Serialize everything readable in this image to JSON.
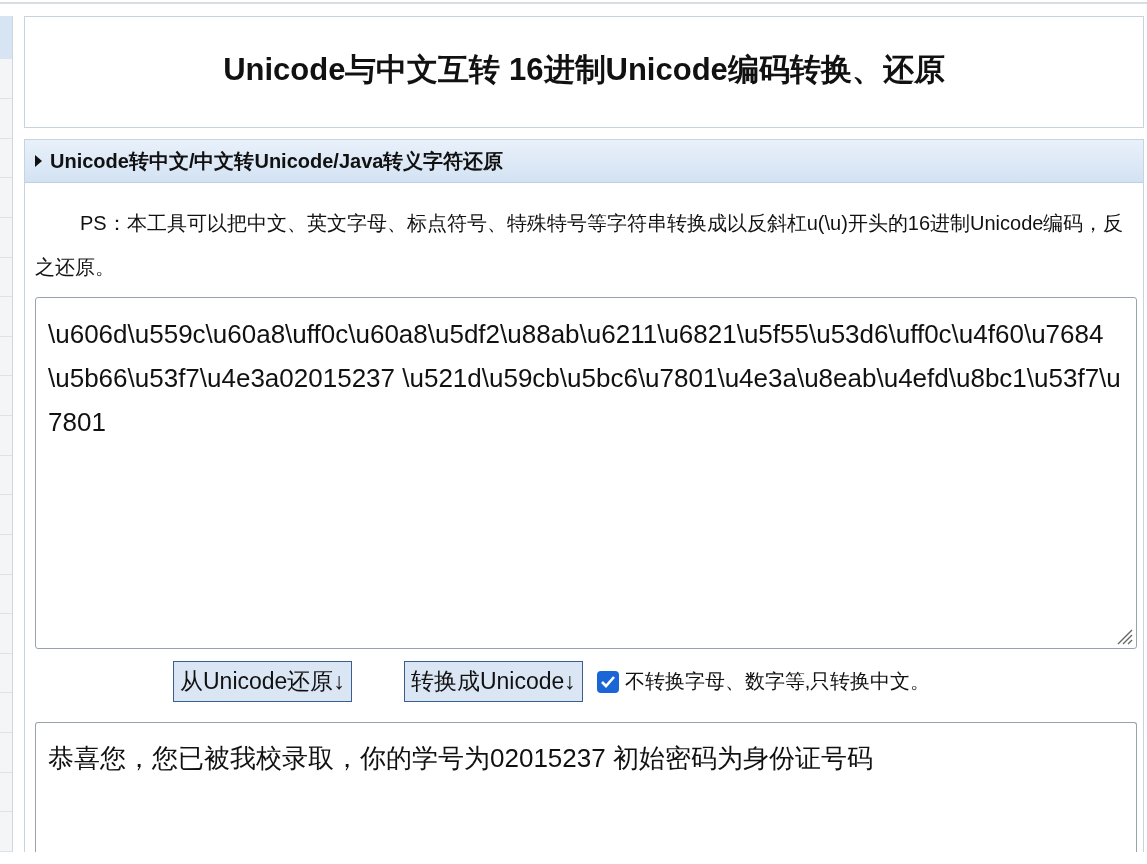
{
  "title": "Unicode与中文互转 16进制Unicode编码转换、还原",
  "section": {
    "heading": "Unicode转中文/中文转Unicode/Java转义字符还原",
    "expanded": false,
    "description": "PS：本工具可以把中文、英文字母、标点符号、特殊特号等字符串转换成以反斜杠u(\\u)开头的16进制Unicode编码，反之还原。",
    "input": {
      "value": "\\u606d\\u559c\\u60a8\\uff0c\\u60a8\\u5df2\\u88ab\\u6211\\u6821\\u5f55\\u53d6\\uff0c\\u4f60\\u7684\\u5b66\\u53f7\\u4e3a02015237 \\u521d\\u59cb\\u5bc6\\u7801\\u4e3a\\u8eab\\u4efd\\u8bc1\\u53f7\\u7801"
    },
    "buttons": [
      "从Unicode还原↓",
      "转换成Unicode↓"
    ],
    "option": {
      "label": "不转换字母、数字等,只转换中文。",
      "checked": true
    },
    "output": {
      "value": "恭喜您，您已被我校录取，你的学号为02015237 初始密码为身份证号码"
    }
  }
}
